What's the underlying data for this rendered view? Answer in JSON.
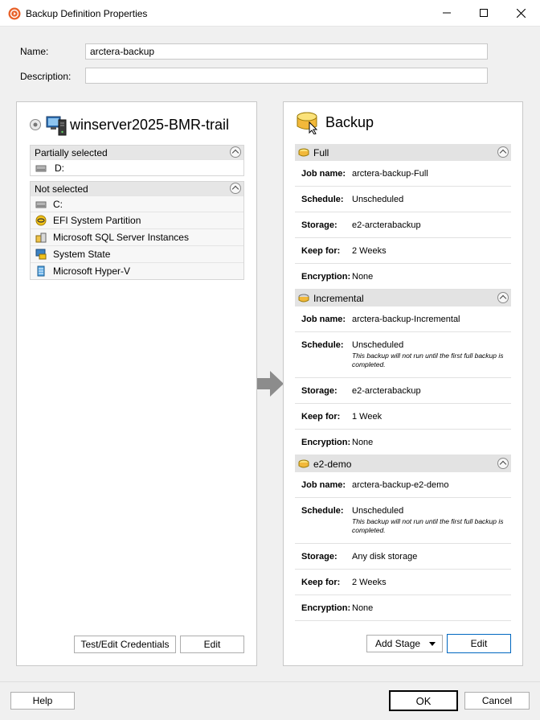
{
  "window": {
    "title": "Backup Definition Properties"
  },
  "form": {
    "name_label": "Name:",
    "name_value": "arctera-backup",
    "description_label": "Description:",
    "description_value": ""
  },
  "selection": {
    "host": "winserver2025-BMR-trail",
    "groups": [
      {
        "title": "Partially selected",
        "items": [
          {
            "label": "D:",
            "icon": "drive-icon"
          }
        ]
      },
      {
        "title": "Not selected",
        "items": [
          {
            "label": "C:",
            "icon": "drive-icon"
          },
          {
            "label": "EFI System Partition",
            "icon": "efi-icon"
          },
          {
            "label": "Microsoft SQL Server Instances",
            "icon": "sql-server-icon"
          },
          {
            "label": "System State",
            "icon": "system-state-icon"
          },
          {
            "label": "Microsoft Hyper-V",
            "icon": "hyperv-icon"
          }
        ]
      }
    ],
    "test_credentials_label": "Test/Edit Credentials",
    "edit_label": "Edit"
  },
  "backup": {
    "title": "Backup",
    "stages": [
      {
        "name": "Full",
        "rows": [
          {
            "key": "Job name:",
            "value": "arctera-backup-Full"
          },
          {
            "key": "Schedule:",
            "value": "Unscheduled"
          },
          {
            "key": "Storage:",
            "value": "e2-arcterabackup"
          },
          {
            "key": "Keep for:",
            "value": "2 Weeks"
          },
          {
            "key": "Encryption:",
            "value": "None"
          }
        ]
      },
      {
        "name": "Incremental",
        "rows": [
          {
            "key": "Job name:",
            "value": "arctera-backup-Incremental"
          },
          {
            "key": "Schedule:",
            "value": "Unscheduled",
            "note": "This backup will not run until the first full backup is completed."
          },
          {
            "key": "Storage:",
            "value": "e2-arcterabackup"
          },
          {
            "key": "Keep for:",
            "value": "1 Week"
          },
          {
            "key": "Encryption:",
            "value": "None"
          }
        ]
      },
      {
        "name": "e2-demo",
        "rows": [
          {
            "key": "Job name:",
            "value": "arctera-backup-e2-demo"
          },
          {
            "key": "Schedule:",
            "value": "Unscheduled",
            "note": "This backup will not run until the first full backup is completed."
          },
          {
            "key": "Storage:",
            "value": "Any disk storage"
          },
          {
            "key": "Keep for:",
            "value": "2 Weeks"
          },
          {
            "key": "Encryption:",
            "value": "None"
          }
        ]
      }
    ],
    "add_stage_label": "Add Stage",
    "edit_label": "Edit"
  },
  "footer": {
    "help_label": "Help",
    "ok_label": "OK",
    "cancel_label": "Cancel"
  }
}
